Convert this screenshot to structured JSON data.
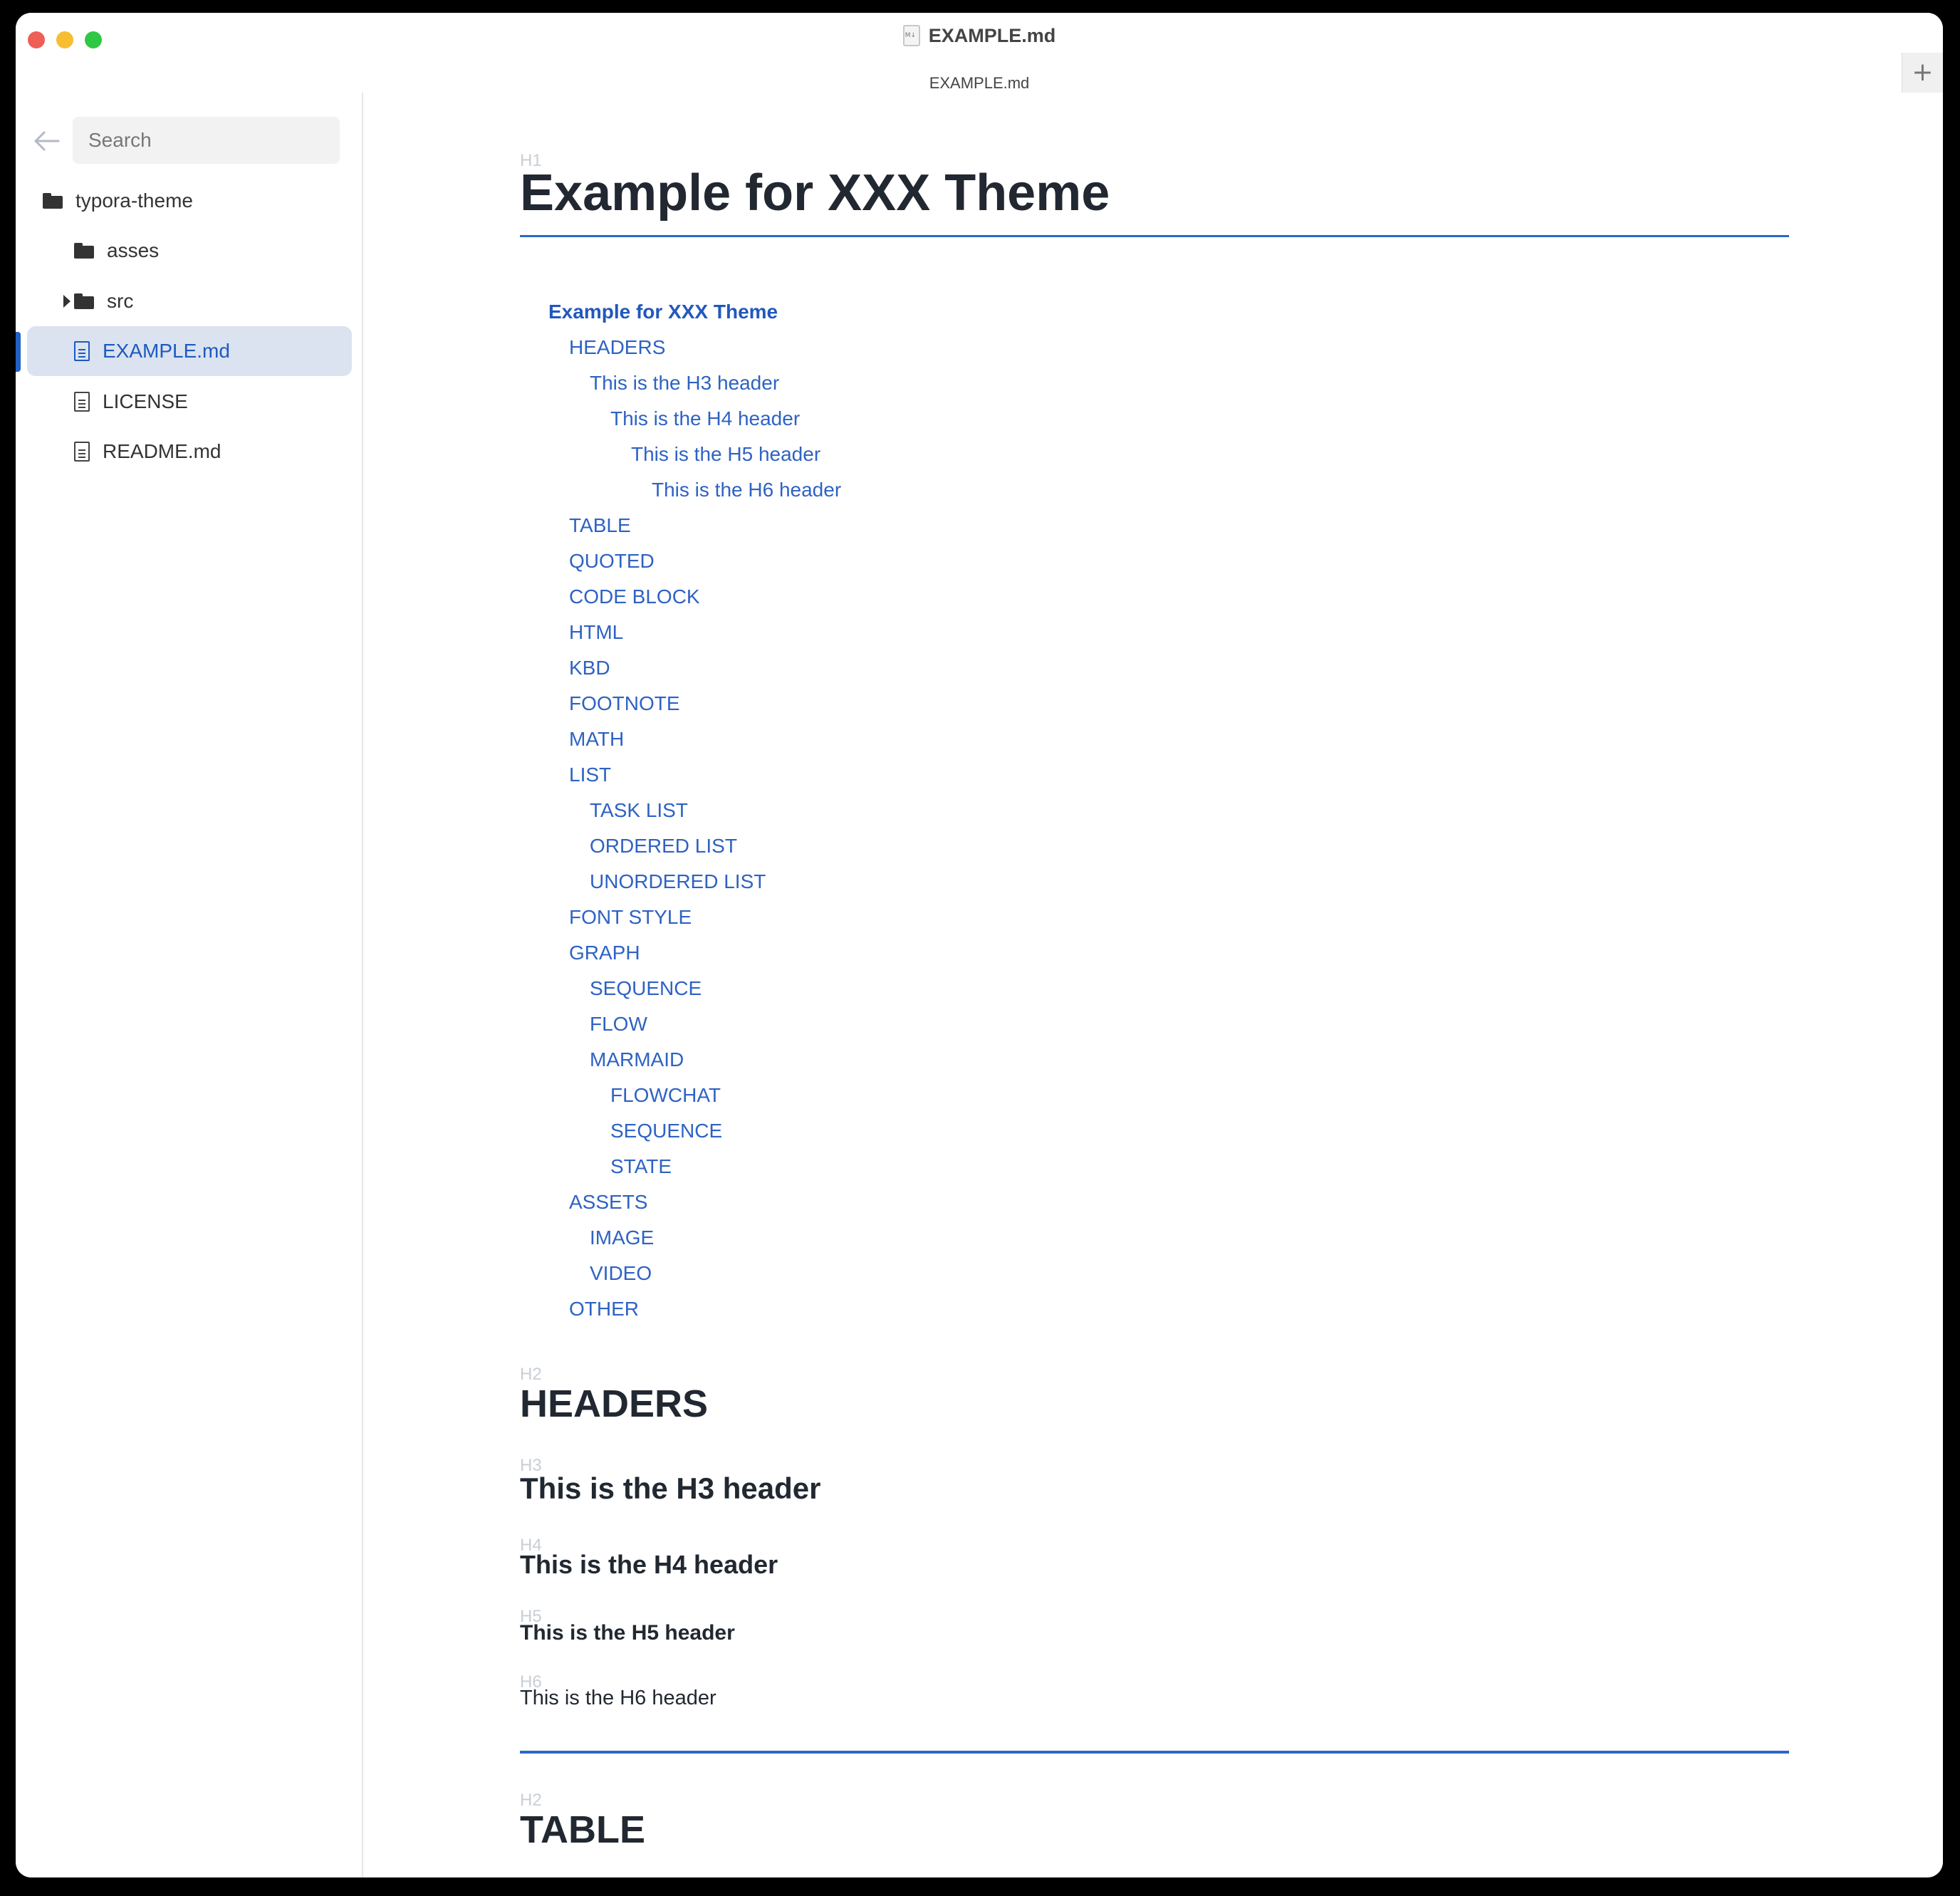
{
  "window": {
    "title": "EXAMPLE.md",
    "tab_label": "EXAMPLE.md",
    "add_tab_label": "+"
  },
  "sidebar": {
    "search_placeholder": "Search",
    "tree": {
      "root": "typora-theme",
      "items": [
        {
          "label": "asses",
          "type": "folder"
        },
        {
          "label": "src",
          "type": "folder",
          "collapsed": true
        },
        {
          "label": "EXAMPLE.md",
          "type": "file",
          "active": true
        },
        {
          "label": "LICENSE",
          "type": "file"
        },
        {
          "label": "README.md",
          "type": "file"
        }
      ]
    }
  },
  "document": {
    "h1_label": "H1",
    "h1_title": "Example for XXX Theme",
    "toc": [
      {
        "label": "Example for XXX Theme",
        "level": 1
      },
      {
        "label": "HEADERS",
        "level": 2
      },
      {
        "label": "This is the H3 header",
        "level": 3
      },
      {
        "label": "This is the H4 header",
        "level": 4
      },
      {
        "label": "This is the H5 header",
        "level": 5
      },
      {
        "label": "This is the H6 header",
        "level": 6
      },
      {
        "label": "TABLE",
        "level": 2
      },
      {
        "label": "QUOTED",
        "level": 2
      },
      {
        "label": "CODE BLOCK",
        "level": 2
      },
      {
        "label": "HTML",
        "level": 2
      },
      {
        "label": "KBD",
        "level": 2
      },
      {
        "label": "FOOTNOTE",
        "level": 2
      },
      {
        "label": "MATH",
        "level": 2
      },
      {
        "label": "LIST",
        "level": 2
      },
      {
        "label": "TASK LIST",
        "level": 3
      },
      {
        "label": "ORDERED LIST",
        "level": 3
      },
      {
        "label": "UNORDERED LIST",
        "level": 3
      },
      {
        "label": "FONT STYLE",
        "level": 2
      },
      {
        "label": "GRAPH",
        "level": 2
      },
      {
        "label": "SEQUENCE",
        "level": 3
      },
      {
        "label": "FLOW",
        "level": 3
      },
      {
        "label": "MARMAID",
        "level": 3
      },
      {
        "label": "FLOWCHAT",
        "level": 4
      },
      {
        "label": "SEQUENCE",
        "level": 4
      },
      {
        "label": "STATE",
        "level": 4
      },
      {
        "label": "ASSETS",
        "level": 2
      },
      {
        "label": "IMAGE",
        "level": 3
      },
      {
        "label": "VIDEO",
        "level": 3
      },
      {
        "label": "OTHER",
        "level": 2
      }
    ],
    "headers_section": {
      "h2_label": "H2",
      "h2_title": "HEADERS",
      "h3_label": "H3",
      "h3_title": "This is the H3 header",
      "h4_label": "H4",
      "h4_title": "This is the H4 header",
      "h5_label": "H5",
      "h5_title": "This is the H5 header",
      "h6_label": "H6",
      "h6_title": "This is the H6 header"
    },
    "table_section": {
      "h2_label": "H2",
      "h2_title": "TABLE"
    }
  },
  "colors": {
    "accent": "#2d67c6",
    "toc_link": "#2e62c4",
    "active_item_bg": "#dbe3f0",
    "heading_text": "#222831",
    "header_hint": "#c9ced6"
  }
}
